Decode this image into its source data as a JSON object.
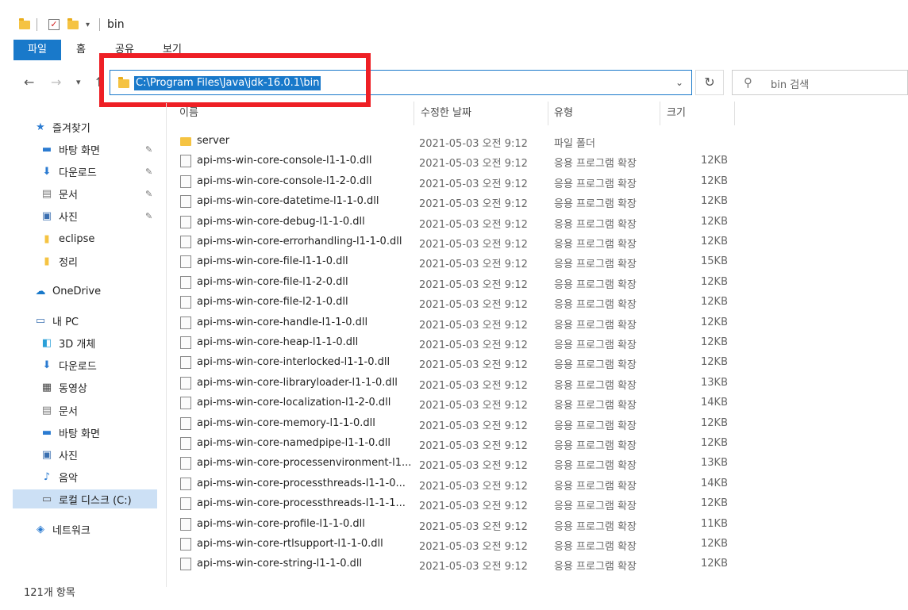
{
  "window": {
    "title": "bin"
  },
  "ribbon": {
    "tabs": [
      "파일",
      "홈",
      "공유",
      "보기"
    ]
  },
  "address": {
    "path": "C:\\Program Files\\Java\\jdk-16.0.1\\bin",
    "search_placeholder": "bin 검색"
  },
  "columns": {
    "name": "이름",
    "date": "수정한 날짜",
    "type": "유형",
    "size": "크기"
  },
  "sidebar": {
    "items": [
      {
        "label": "즐겨찾기",
        "icon": "star-icon"
      },
      {
        "label": "바탕 화면",
        "icon": "desktop-icon",
        "pinned": true
      },
      {
        "label": "다운로드",
        "icon": "download-icon",
        "pinned": true
      },
      {
        "label": "문서",
        "icon": "document-icon",
        "pinned": true
      },
      {
        "label": "사진",
        "icon": "picture-icon",
        "pinned": true
      },
      {
        "label": "eclipse",
        "icon": "folder-icon"
      },
      {
        "label": "정리",
        "icon": "folder-icon"
      },
      {
        "label": "OneDrive",
        "icon": "cloud-icon"
      },
      {
        "label": "내 PC",
        "icon": "pc-icon"
      },
      {
        "label": "3D 개체",
        "icon": "cube-icon"
      },
      {
        "label": "다운로드",
        "icon": "download-icon"
      },
      {
        "label": "동영상",
        "icon": "video-icon"
      },
      {
        "label": "문서",
        "icon": "document-icon"
      },
      {
        "label": "바탕 화면",
        "icon": "desktop-icon"
      },
      {
        "label": "사진",
        "icon": "picture-icon"
      },
      {
        "label": "음악",
        "icon": "music-icon"
      },
      {
        "label": "로컬 디스크 (C:)",
        "icon": "disk-icon",
        "selected": true
      },
      {
        "label": "네트워크",
        "icon": "network-icon"
      }
    ]
  },
  "files": [
    {
      "name": "server",
      "date": "2021-05-03 오전 9:12",
      "type": "파일 폴더",
      "size": ""
    },
    {
      "name": "api-ms-win-core-console-l1-1-0.dll",
      "date": "2021-05-03 오전 9:12",
      "type": "응용 프로그램 확장",
      "size": "12KB"
    },
    {
      "name": "api-ms-win-core-console-l1-2-0.dll",
      "date": "2021-05-03 오전 9:12",
      "type": "응용 프로그램 확장",
      "size": "12KB"
    },
    {
      "name": "api-ms-win-core-datetime-l1-1-0.dll",
      "date": "2021-05-03 오전 9:12",
      "type": "응용 프로그램 확장",
      "size": "12KB"
    },
    {
      "name": "api-ms-win-core-debug-l1-1-0.dll",
      "date": "2021-05-03 오전 9:12",
      "type": "응용 프로그램 확장",
      "size": "12KB"
    },
    {
      "name": "api-ms-win-core-errorhandling-l1-1-0.dll",
      "date": "2021-05-03 오전 9:12",
      "type": "응용 프로그램 확장",
      "size": "12KB"
    },
    {
      "name": "api-ms-win-core-file-l1-1-0.dll",
      "date": "2021-05-03 오전 9:12",
      "type": "응용 프로그램 확장",
      "size": "15KB"
    },
    {
      "name": "api-ms-win-core-file-l1-2-0.dll",
      "date": "2021-05-03 오전 9:12",
      "type": "응용 프로그램 확장",
      "size": "12KB"
    },
    {
      "name": "api-ms-win-core-file-l2-1-0.dll",
      "date": "2021-05-03 오전 9:12",
      "type": "응용 프로그램 확장",
      "size": "12KB"
    },
    {
      "name": "api-ms-win-core-handle-l1-1-0.dll",
      "date": "2021-05-03 오전 9:12",
      "type": "응용 프로그램 확장",
      "size": "12KB"
    },
    {
      "name": "api-ms-win-core-heap-l1-1-0.dll",
      "date": "2021-05-03 오전 9:12",
      "type": "응용 프로그램 확장",
      "size": "12KB"
    },
    {
      "name": "api-ms-win-core-interlocked-l1-1-0.dll",
      "date": "2021-05-03 오전 9:12",
      "type": "응용 프로그램 확장",
      "size": "12KB"
    },
    {
      "name": "api-ms-win-core-libraryloader-l1-1-0.dll",
      "date": "2021-05-03 오전 9:12",
      "type": "응용 프로그램 확장",
      "size": "13KB"
    },
    {
      "name": "api-ms-win-core-localization-l1-2-0.dll",
      "date": "2021-05-03 오전 9:12",
      "type": "응용 프로그램 확장",
      "size": "14KB"
    },
    {
      "name": "api-ms-win-core-memory-l1-1-0.dll",
      "date": "2021-05-03 오전 9:12",
      "type": "응용 프로그램 확장",
      "size": "12KB"
    },
    {
      "name": "api-ms-win-core-namedpipe-l1-1-0.dll",
      "date": "2021-05-03 오전 9:12",
      "type": "응용 프로그램 확장",
      "size": "12KB"
    },
    {
      "name": "api-ms-win-core-processenvironment-l1...",
      "date": "2021-05-03 오전 9:12",
      "type": "응용 프로그램 확장",
      "size": "13KB"
    },
    {
      "name": "api-ms-win-core-processthreads-l1-1-0...",
      "date": "2021-05-03 오전 9:12",
      "type": "응용 프로그램 확장",
      "size": "14KB"
    },
    {
      "name": "api-ms-win-core-processthreads-l1-1-1...",
      "date": "2021-05-03 오전 9:12",
      "type": "응용 프로그램 확장",
      "size": "12KB"
    },
    {
      "name": "api-ms-win-core-profile-l1-1-0.dll",
      "date": "2021-05-03 오전 9:12",
      "type": "응용 프로그램 확장",
      "size": "11KB"
    },
    {
      "name": "api-ms-win-core-rtlsupport-l1-1-0.dll",
      "date": "2021-05-03 오전 9:12",
      "type": "응용 프로그램 확장",
      "size": "12KB"
    },
    {
      "name": "api-ms-win-core-string-l1-1-0.dll",
      "date": "2021-05-03 오전 9:12",
      "type": "응용 프로그램 확장",
      "size": "12KB"
    }
  ],
  "status": {
    "item_count": "121개 항목"
  },
  "colors": {
    "accent": "#1979ca",
    "highlight": "#ee1f25",
    "folder": "#f5c342"
  }
}
